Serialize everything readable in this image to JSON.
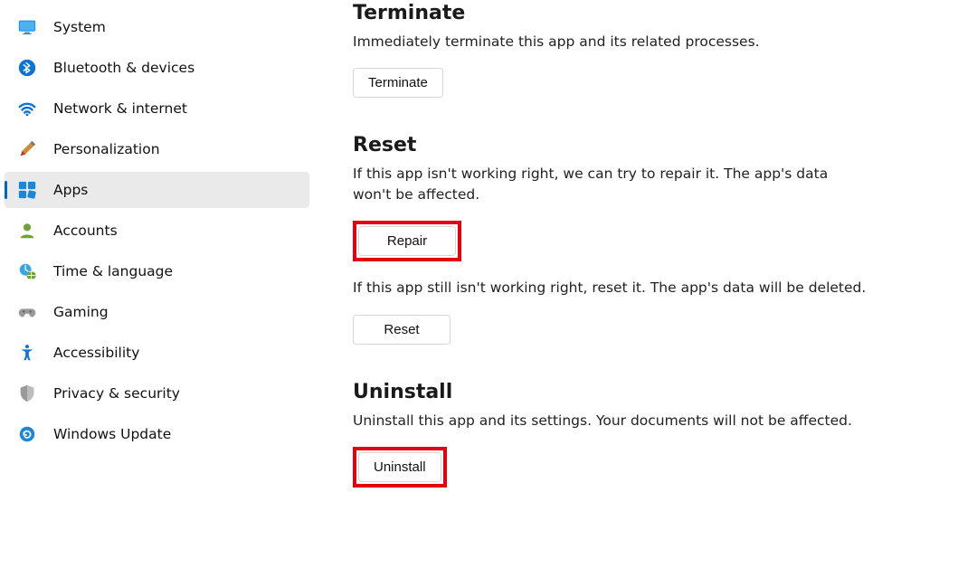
{
  "sidebar": {
    "items": [
      {
        "label": "System"
      },
      {
        "label": "Bluetooth & devices"
      },
      {
        "label": "Network & internet"
      },
      {
        "label": "Personalization"
      },
      {
        "label": "Apps"
      },
      {
        "label": "Accounts"
      },
      {
        "label": "Time & language"
      },
      {
        "label": "Gaming"
      },
      {
        "label": "Accessibility"
      },
      {
        "label": "Privacy & security"
      },
      {
        "label": "Windows Update"
      }
    ]
  },
  "terminate": {
    "title": "Terminate",
    "desc": "Immediately terminate this app and its related processes.",
    "button": "Terminate"
  },
  "reset": {
    "title": "Reset",
    "desc1": "If this app isn't working right, we can try to repair it. The app's data won't be affected.",
    "repair_button": "Repair",
    "desc2": "If this app still isn't working right, reset it. The app's data will be deleted.",
    "reset_button": "Reset"
  },
  "uninstall": {
    "title": "Uninstall",
    "desc": "Uninstall this app and its settings. Your documents will not be affected.",
    "button": "Uninstall"
  }
}
